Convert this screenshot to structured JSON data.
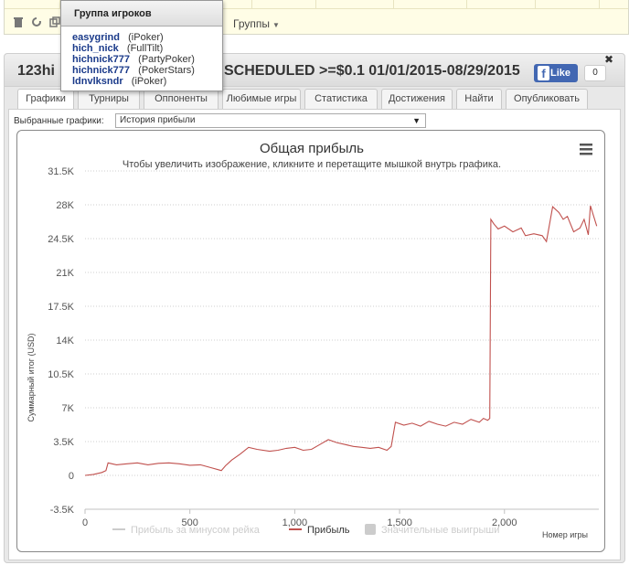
{
  "popup": {
    "title": "Группа игроков",
    "players": [
      {
        "name": "easygrind",
        "site": "(iPoker)"
      },
      {
        "name": "hich_nick",
        "site": "(FullTilt)"
      },
      {
        "name": "hichnick777",
        "site": "(PartyPoker)"
      },
      {
        "name": "hichnick777",
        "site": "(PokerStars)"
      },
      {
        "name": "ldnvlksndr",
        "site": "(iPoker)"
      }
    ]
  },
  "toolbar": {
    "groups_label": "Группы"
  },
  "header": {
    "title_left": "123hi",
    "title_right": "SCHEDULED >=$0.1 01/01/2015-08/29/2015",
    "fb_like": "Like",
    "fb_count": "0"
  },
  "tabs": [
    {
      "label": "Графики",
      "active": true
    },
    {
      "label": "Турниры"
    },
    {
      "label": "Оппоненты"
    },
    {
      "label": "Любимые игры"
    },
    {
      "label": "Статистика"
    },
    {
      "label": "Достижения"
    },
    {
      "label": "Найти"
    },
    {
      "label": "Опубликовать"
    }
  ],
  "selector": {
    "label": "Выбранные графики:",
    "value": "История прибыли"
  },
  "chart_data": {
    "type": "line",
    "title": "Общая прибыль",
    "subtitle": "Чтобы увеличить изображение, кликните и перетащите мышкой внутрь графика.",
    "xlabel": "Номер игры",
    "ylabel": "Суммарный итог (USD)",
    "xlim": [
      0,
      2450
    ],
    "ylim": [
      -3500,
      31500
    ],
    "x_ticks": [
      "0",
      "500",
      "1,000",
      "1,500",
      "2,000"
    ],
    "y_ticks": [
      "31.5K",
      "28K",
      "24.5K",
      "21K",
      "17.5K",
      "14K",
      "10.5K",
      "7K",
      "3.5K",
      "0",
      "-3.5K"
    ],
    "legend": [
      {
        "name": "Прибыль за минусом рейка",
        "color": "#cccccc"
      },
      {
        "name": "Прибыль",
        "color": "#c0504d"
      },
      {
        "name": "Значительные выигрыши",
        "color": "#cccccc"
      }
    ],
    "series": [
      {
        "name": "Прибыль",
        "color": "#c0504d",
        "x": [
          0,
          40,
          80,
          100,
          110,
          150,
          200,
          250,
          300,
          350,
          400,
          450,
          500,
          550,
          600,
          650,
          670,
          700,
          740,
          780,
          820,
          880,
          920,
          960,
          1000,
          1040,
          1080,
          1120,
          1160,
          1200,
          1240,
          1280,
          1320,
          1360,
          1400,
          1440,
          1460,
          1480,
          1520,
          1560,
          1600,
          1640,
          1680,
          1720,
          1760,
          1800,
          1840,
          1880,
          1900,
          1920,
          1930,
          1935,
          1950,
          1970,
          2000,
          2040,
          2080,
          2100,
          2140,
          2180,
          2200,
          2230,
          2260,
          2280,
          2300,
          2330,
          2360,
          2380,
          2400,
          2410,
          2420,
          2440
        ],
        "y": [
          0,
          100,
          300,
          500,
          1300,
          1100,
          1200,
          1300,
          1100,
          1250,
          1300,
          1200,
          1050,
          1100,
          800,
          500,
          1000,
          1600,
          2200,
          2900,
          2700,
          2500,
          2600,
          2800,
          2900,
          2600,
          2700,
          3200,
          3700,
          3400,
          3200,
          3000,
          2900,
          2800,
          2900,
          2600,
          3000,
          5500,
          5200,
          5400,
          5100,
          5600,
          5300,
          5100,
          5500,
          5300,
          5800,
          5500,
          5900,
          5700,
          5900,
          26500,
          26000,
          25500,
          25800,
          25200,
          25600,
          24800,
          25000,
          24800,
          24200,
          27800,
          27200,
          26500,
          26800,
          25200,
          25600,
          26500,
          24900,
          27900,
          27200,
          25800
        ]
      }
    ]
  }
}
